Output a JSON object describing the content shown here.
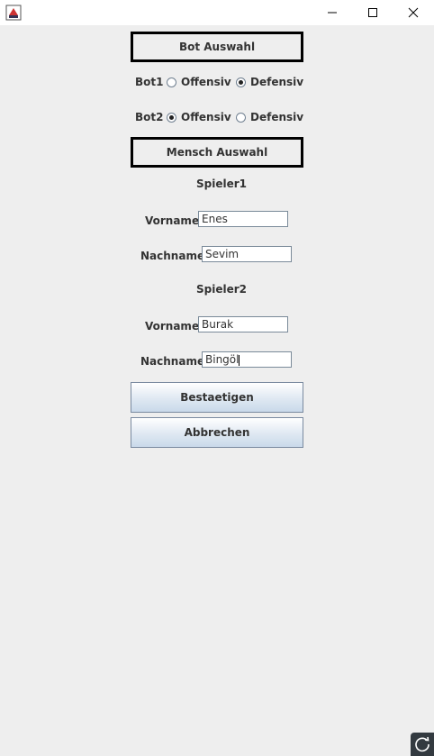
{
  "window": {
    "app_icon": "java-app-icon",
    "minimize_icon": "minimize-icon",
    "maximize_icon": "maximize-icon",
    "close_icon": "close-icon"
  },
  "bot_section": {
    "title": "Bot Auswahl",
    "bots": [
      {
        "label": "Bot1",
        "options": [
          "Offensiv",
          "Defensiv"
        ],
        "selected": "Defensiv"
      },
      {
        "label": "Bot2",
        "options": [
          "Offensiv",
          "Defensiv"
        ],
        "selected": "Offensiv"
      }
    ]
  },
  "human_section": {
    "title": "Mensch Auswahl",
    "players": [
      {
        "heading": "Spieler1",
        "vorname_label": "Vorname:",
        "vorname": "Enes",
        "nachname_label": "Nachname:",
        "nachname": "Sevim"
      },
      {
        "heading": "Spieler2",
        "vorname_label": "Vorname:",
        "vorname": "Burak",
        "nachname_label": "Nachname:",
        "nachname": "Bingöl"
      }
    ]
  },
  "buttons": {
    "confirm": "Bestaetigen",
    "cancel": "Abbrechen"
  },
  "overlay_icon": "refresh-icon"
}
